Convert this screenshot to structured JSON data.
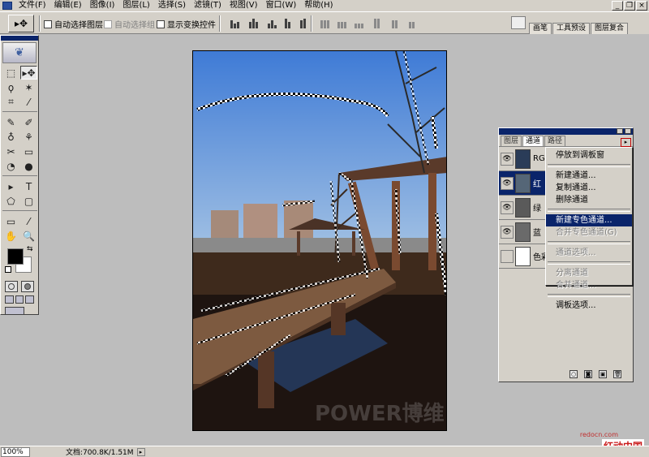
{
  "menubar": {
    "app_icon": "photoshop-icon",
    "items": [
      "文件(F)",
      "编辑(E)",
      "图像(I)",
      "图层(L)",
      "选择(S)",
      "滤镜(T)",
      "视图(V)",
      "窗口(W)",
      "帮助(H)"
    ],
    "window_buttons": [
      "_",
      "❐",
      "×"
    ]
  },
  "options": {
    "tool_glyph": "▸✥",
    "auto_select_layer": "自动选择图层",
    "auto_select_group": "自动选择组",
    "show_transform": "显示变换控件"
  },
  "palette_well": {
    "tabs": [
      "画笔",
      "工具预设",
      "图层复合"
    ]
  },
  "toolbox": {
    "logo": "❦",
    "tools": [
      "⬚",
      "▸✥",
      "ϙ",
      "✶",
      "⌗",
      "⁄",
      "✎",
      "✐",
      "♁",
      "⚘",
      "✂",
      "▭",
      "◔",
      "●",
      "▸",
      "T",
      "⬠",
      "▢",
      "▭",
      "⁄",
      "✋",
      "🔍"
    ],
    "swap": "⇆"
  },
  "channels_panel": {
    "tabs": [
      "图层",
      "通道",
      "路径"
    ],
    "active_tab": "通道",
    "menu_button": "▸",
    "rows": [
      {
        "label": "RGB",
        "eye": "👁",
        "thumb_color": "#2a3c58"
      },
      {
        "label": "红",
        "eye": "👁",
        "thumb_color": "#556677",
        "selected": true
      },
      {
        "label": "绿",
        "eye": "👁",
        "thumb_color": "#5a5a5a"
      },
      {
        "label": "蓝",
        "eye": "👁",
        "thumb_color": "#6a6a6a"
      },
      {
        "label": "色彩",
        "eye": "",
        "thumb_color": "#ffffff"
      }
    ],
    "footer_icons": [
      "○",
      "◙",
      "▣",
      "🗑"
    ]
  },
  "channel_menu": {
    "groups": [
      [
        {
          "label": "停放到调板窗",
          "enabled": true
        }
      ],
      [
        {
          "label": "新建通道...",
          "enabled": true
        },
        {
          "label": "复制通道...",
          "enabled": true
        },
        {
          "label": "删除通道",
          "enabled": true
        }
      ],
      [
        {
          "label": "新建专色通道...",
          "enabled": true,
          "highlighted": true
        },
        {
          "label": "合并专色通道(G)",
          "enabled": false
        }
      ],
      [
        {
          "label": "通道选项...",
          "enabled": false
        }
      ],
      [
        {
          "label": "分离通道",
          "enabled": false
        },
        {
          "label": "合并通道...",
          "enabled": false
        }
      ],
      [
        {
          "label": "调板选项...",
          "enabled": true
        }
      ]
    ]
  },
  "canvas": {
    "watermark": "POWER博维"
  },
  "status": {
    "zoom": "100%",
    "doc": "文档:700.8K/1.51M",
    "arrow": "▸"
  },
  "site_watermark": {
    "url": "redocn.com",
    "name": "红动中国"
  },
  "colors": {
    "titlebar": "#0a246a",
    "ui_gray": "#d4d0c8",
    "sky_top": "#3f7bd6",
    "sky_bottom": "#cfdbe8"
  }
}
